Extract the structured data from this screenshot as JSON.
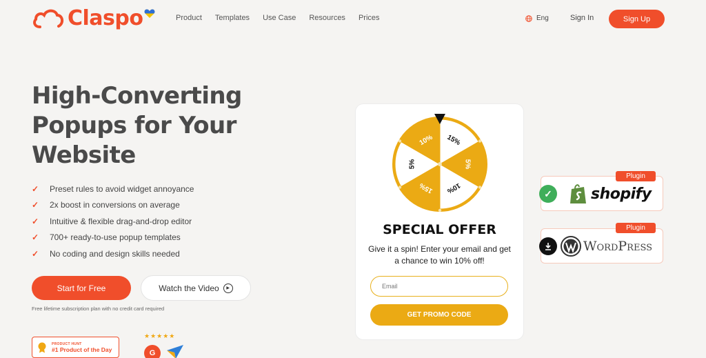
{
  "header": {
    "logo_text": "Claspo",
    "nav": [
      "Product",
      "Templates",
      "Use Case",
      "Resources",
      "Prices"
    ],
    "language": "Eng",
    "sign_in": "Sign In",
    "sign_up": "Sign Up"
  },
  "hero": {
    "title_lines": [
      "High-Converting",
      "Popups for Your",
      "Website"
    ],
    "features": [
      "Preset rules to avoid widget annoyance",
      "2x boost in conversions on average",
      "Intuitive & flexible drag-and-drop editor",
      "700+ ready-to-use popup templates",
      "No coding and design skills needed"
    ],
    "cta_primary": "Start for Free",
    "cta_secondary": "Watch the Video",
    "note": "Free lifetime subscription plan with no credit card required"
  },
  "badges": {
    "product_hunt_small": "PRODUCT HUNT",
    "product_hunt_big": "#1 Product of the Day",
    "stars": "★★★★★",
    "g2": "G"
  },
  "popup": {
    "wheel_segments": [
      "15%",
      "5%",
      "10%",
      "15%",
      "5%",
      "10%"
    ],
    "title": "SPECIAL OFFER",
    "text": "Give it a spin! Enter your email and get a chance to win 10% off!",
    "email_placeholder": "Email",
    "button": "GET PROMO CODE"
  },
  "integrations": [
    {
      "tag": "Plugin",
      "name": "shopify",
      "status_icon": "check-icon"
    },
    {
      "tag": "Plugin",
      "name": "WordPress",
      "status_icon": "download-icon"
    }
  ],
  "colors": {
    "brand": "#f04e2b",
    "wheel": "#ebaa14",
    "green": "#3fae5a"
  }
}
